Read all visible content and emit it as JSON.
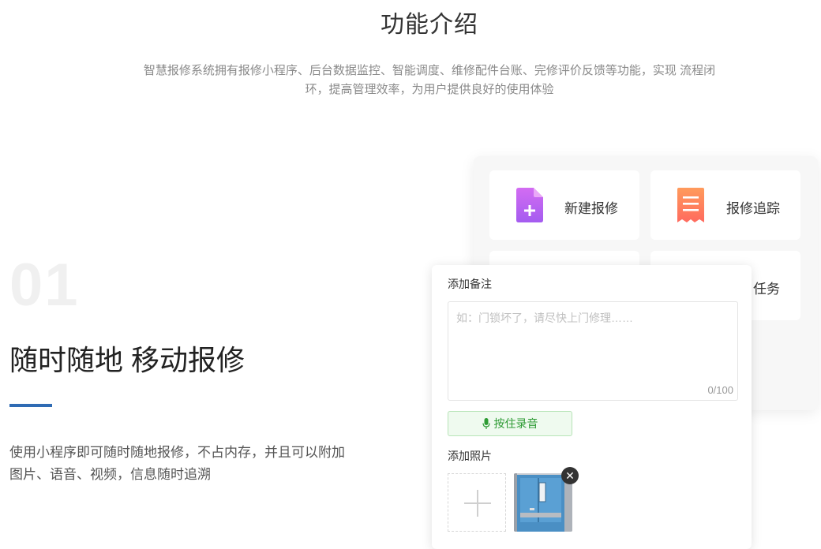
{
  "header": {
    "title": "功能介绍",
    "intro_line1": "智慧报修系统拥有报修小程序、后台数据监控、智能调度、维修配件台账、完修评价反馈等功能，实现 流程闭",
    "intro_line2": "环，提高管理效率，为用户提供良好的使用体验"
  },
  "feature": {
    "number": "01",
    "title": "随时随地 移动报修",
    "desc_line1": "使用小程序即可随时随地报修，不占内存，并且可以附加",
    "desc_line2": "图片、语音、视频，信息随时追溯"
  },
  "tiles": [
    {
      "label": "新建报修",
      "icon": "new-document-icon",
      "color": "#b45cf0"
    },
    {
      "label": "报修追踪",
      "icon": "receipt-list-icon",
      "color": "#ff7b5a"
    },
    {
      "label": "任务"
    }
  ],
  "form": {
    "note_label": "添加备注",
    "note_placeholder": "如：门锁坏了，请尽快上门修理……",
    "note_counter": "0/100",
    "record_label": "按住录音",
    "photo_label": "添加照片"
  },
  "colors": {
    "accent_blue": "#2f6bb4",
    "record_green": "#2e9b34"
  }
}
